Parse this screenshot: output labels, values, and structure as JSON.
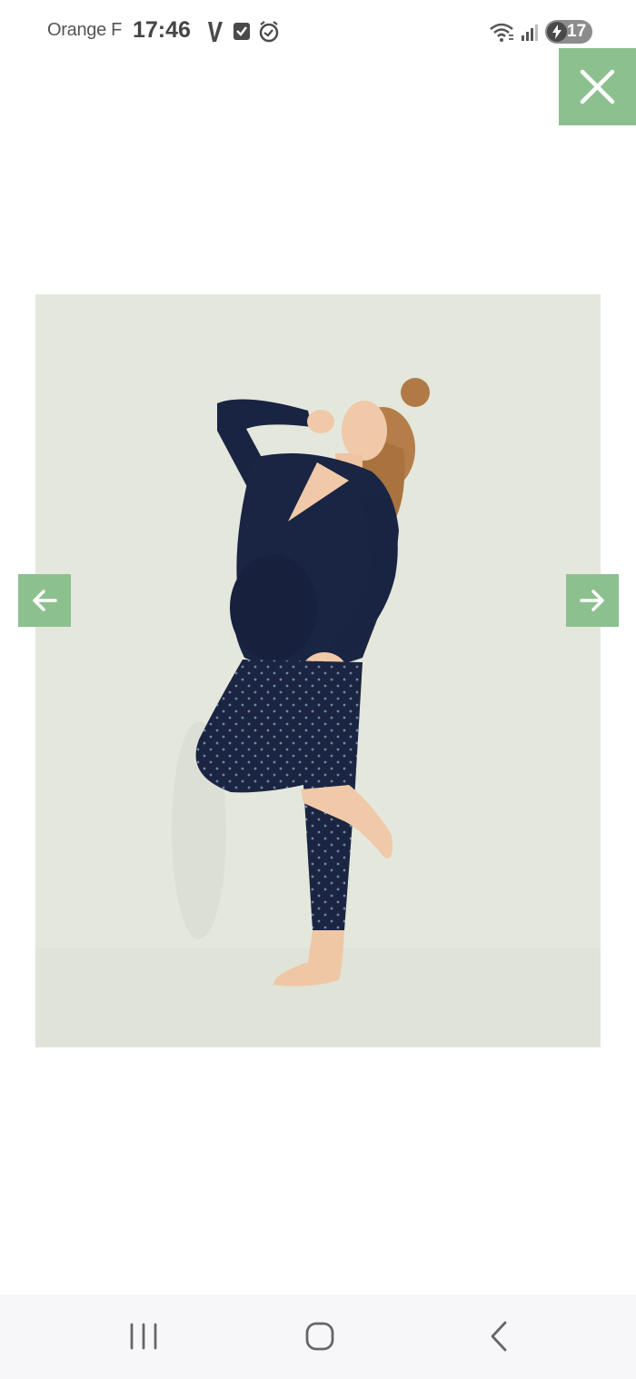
{
  "status_bar": {
    "carrier": "Orange F",
    "time": "17:46",
    "battery_level": "17",
    "icons": [
      "v-app-icon",
      "check-box-icon",
      "alarm-icon",
      "wifi-icon",
      "signal-icon",
      "battery-charging-icon"
    ]
  },
  "viewer": {
    "close_icon": "close-icon",
    "prev_icon": "arrow-left-icon",
    "next_icon": "arrow-right-icon",
    "accent_color": "#8dc08f",
    "photo_background": "#e4e7dc"
  },
  "nav_bar": {
    "icons": [
      "recent-apps-icon",
      "home-icon",
      "back-icon"
    ]
  }
}
